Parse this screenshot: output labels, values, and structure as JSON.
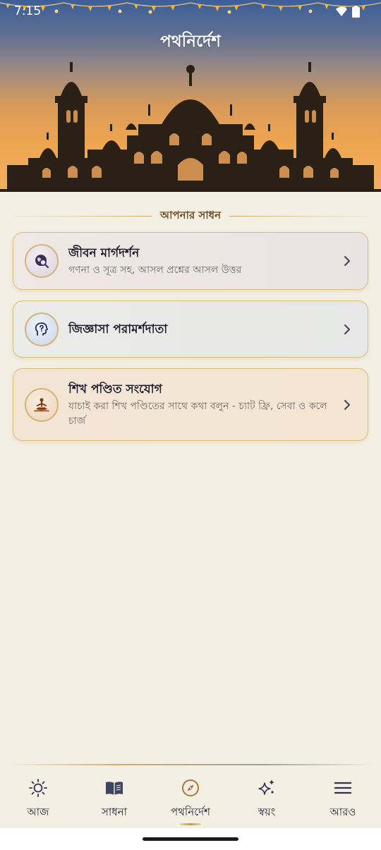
{
  "status_bar": {
    "time": "7:15"
  },
  "header": {
    "title": "পথনির্দেশ"
  },
  "section": {
    "label": "আপনার সাধন"
  },
  "cards": [
    {
      "title": "জীবন মার্গদর্শন",
      "subtitle": "গণনা ও সূত্র সহ, আসল প্রশ্নের আসল উত্তর",
      "icon": "globe-search-icon"
    },
    {
      "title": "জিজ্ঞাসা পরামর্শদাতা",
      "subtitle": "",
      "icon": "head-question-icon"
    },
    {
      "title": "শিখ পণ্ডিত সংযোগ",
      "subtitle": "যাচাই করা শিখ পণ্ডিতের সাথে কথা বলুন - চ্যাট ফ্রি, সেবা ও কলে চার্জ",
      "icon": "meditation-icon"
    }
  ],
  "nav": [
    {
      "label": "আজ",
      "icon": "sun-icon",
      "active": false
    },
    {
      "label": "সাধনা",
      "icon": "book-icon",
      "active": false
    },
    {
      "label": "পথনির্দেশ",
      "icon": "compass-icon",
      "active": true
    },
    {
      "label": "স্বয়ং",
      "icon": "sparkles-icon",
      "active": false
    },
    {
      "label": "আরও",
      "icon": "menu-icon",
      "active": false
    }
  ],
  "colors": {
    "accent_gold": "#c9a865",
    "nav_active": "#c5994a",
    "sky_top": "#3d5f98",
    "sky_bottom": "#f1b063"
  }
}
